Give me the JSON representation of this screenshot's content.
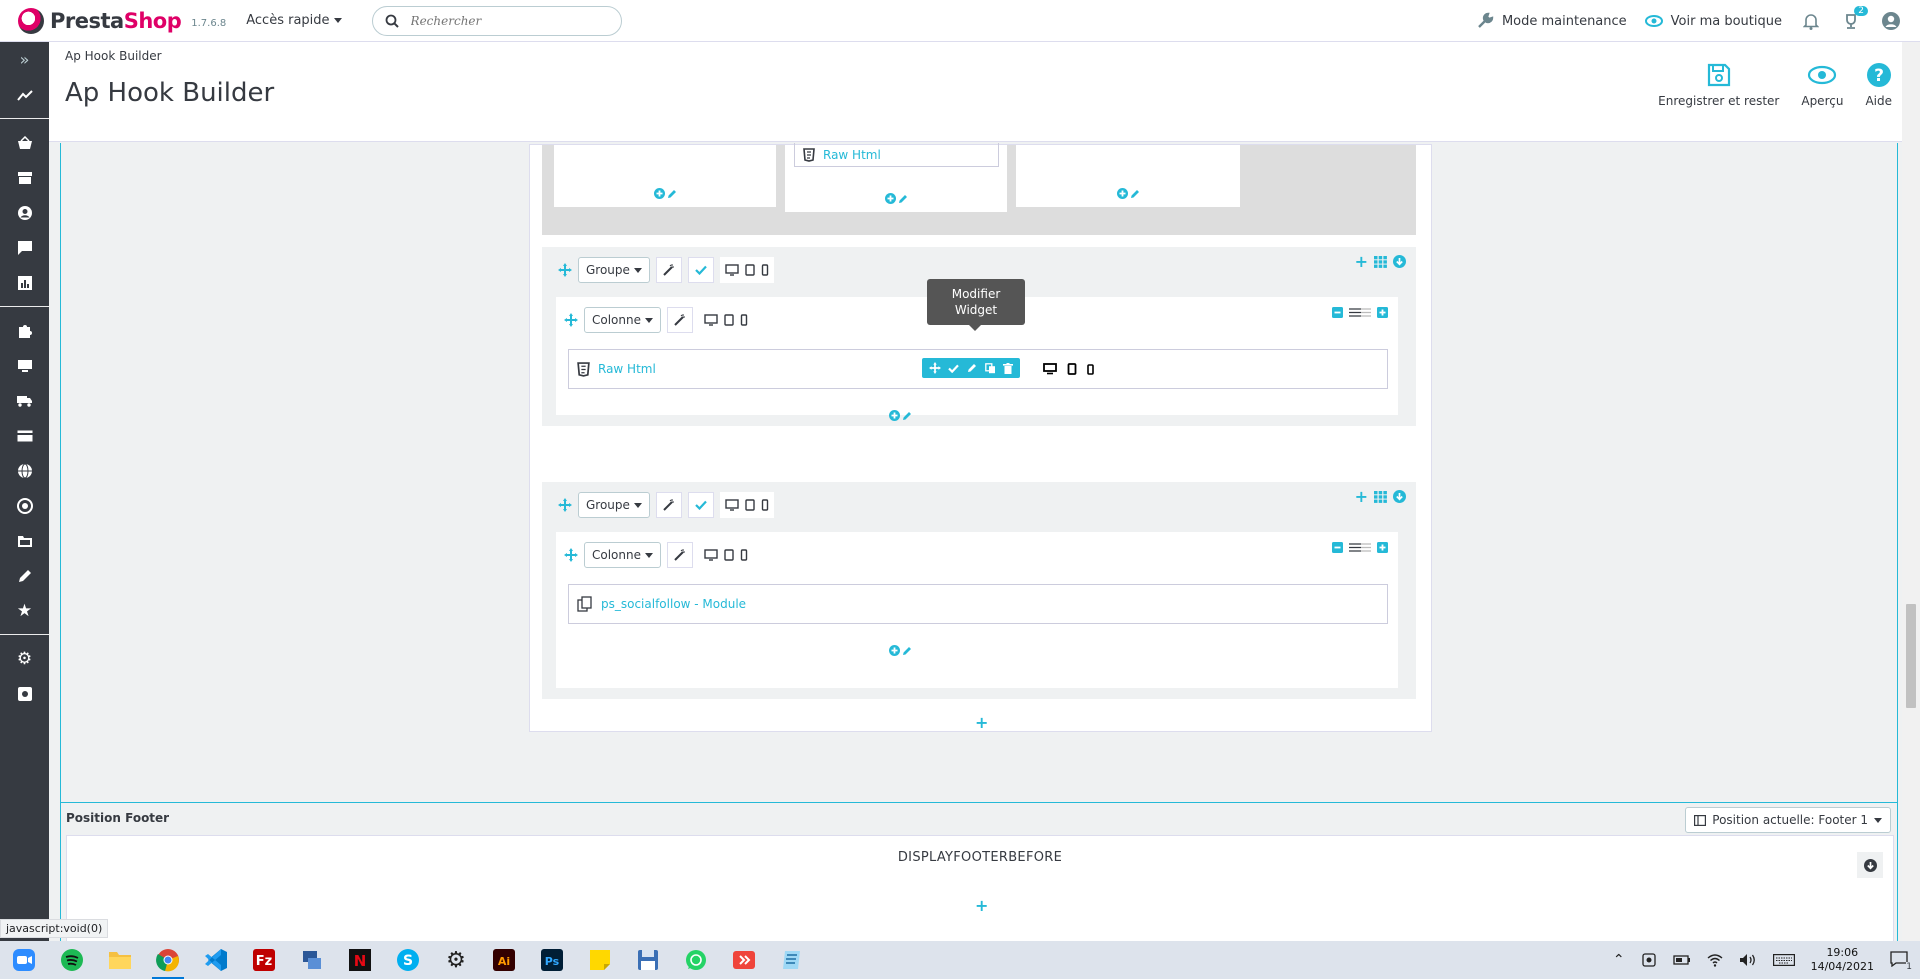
{
  "app": {
    "brand_pre": "Presta",
    "brand_post": "Shop",
    "version": "1.7.6.8",
    "quick_access": "Accès rapide",
    "search_placeholder": "Rechercher"
  },
  "header_right": {
    "maintenance": "Mode maintenance",
    "view_shop": "Voir ma boutique",
    "cart_badge": "2"
  },
  "page": {
    "breadcrumb": "Ap Hook Builder",
    "title": "Ap Hook Builder"
  },
  "toolbar": {
    "save": "Enregistrer et rester",
    "preview": "Aperçu",
    "help": "Aide"
  },
  "builder": {
    "top_row_widget": "Raw Html",
    "group_label": "Groupe",
    "column_label": "Colonne",
    "group1_widget": "Raw Html",
    "group2_widget": "ps_socialfollow - Module",
    "tooltip": "Modifier Widget"
  },
  "footer_panel": {
    "title": "Position Footer",
    "select": "Position actuelle: Footer 1",
    "hook": "DISPLAYFOOTERBEFORE"
  },
  "status_url": "javascript:void(0)",
  "clock": {
    "time": "19:06",
    "date": "14/04/2021"
  },
  "notif_count": "1",
  "colors": {
    "accent": "#25b9d7",
    "brand": "#df0067",
    "sidebar": "#363a41"
  }
}
